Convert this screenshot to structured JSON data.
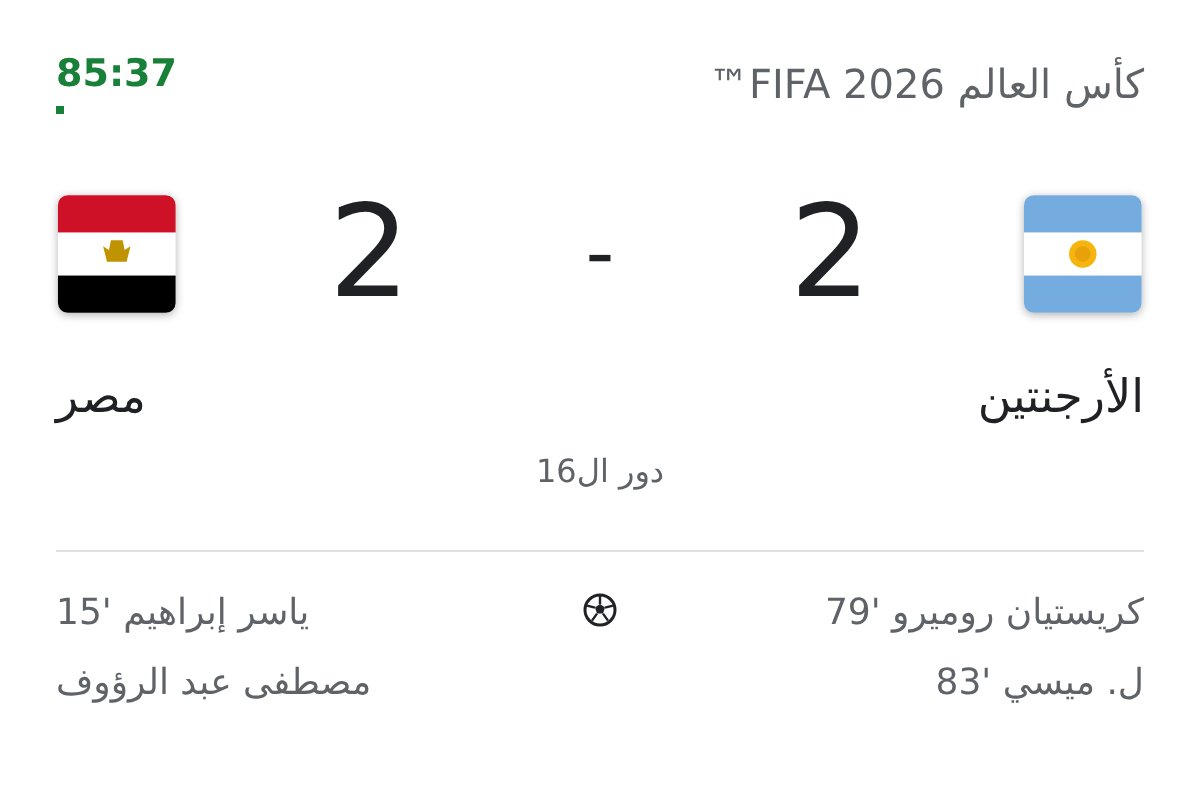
{
  "header": {
    "competition": "كأس العالم FIFA 2026™",
    "clock": "85:37",
    "live": true
  },
  "teams": [
    {
      "name": "الأرجنتين",
      "score": "2",
      "kind": "argentina"
    },
    {
      "name": "مصر",
      "score": "2",
      "kind": "egypt"
    }
  ],
  "score_separator": "-",
  "round": "دور ال16",
  "goals": [
    [
      "كريستيان روميرو '79",
      "ل. ميسي '83"
    ],
    [
      "ياسر إبراهيم '15",
      "مصطفى عبد الرؤوف"
    ]
  ]
}
